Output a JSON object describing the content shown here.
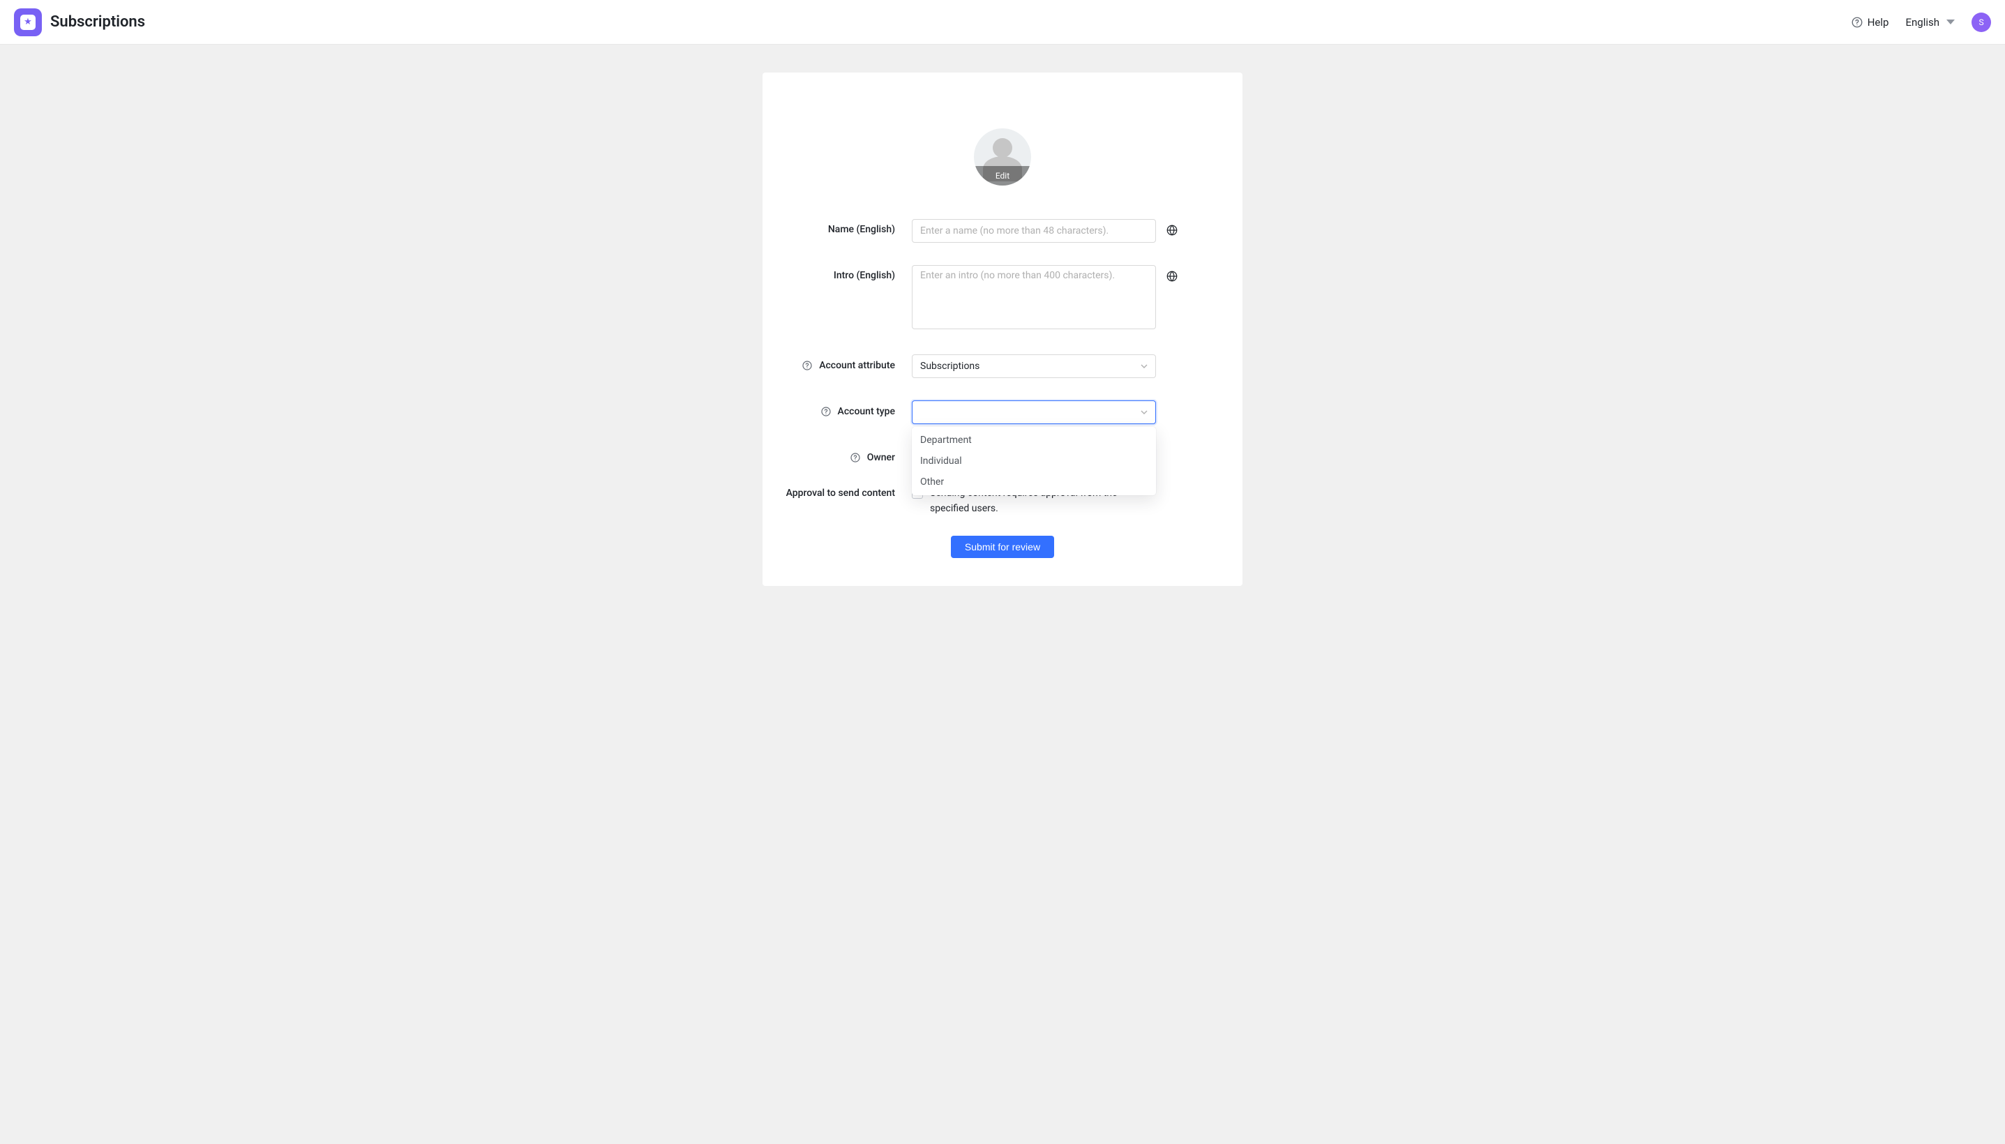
{
  "header": {
    "title": "Subscriptions",
    "help_label": "Help",
    "language_label": "English",
    "avatar_initial": "S"
  },
  "avatar": {
    "edit_label": "Edit"
  },
  "form": {
    "name": {
      "label": "Name (English)",
      "placeholder": "Enter a name (no more than 48 characters).",
      "value": ""
    },
    "intro": {
      "label": "Intro (English)",
      "placeholder": "Enter an intro (no more than 400 characters).",
      "value": ""
    },
    "account_attribute": {
      "label": "Account attribute",
      "value": "Subscriptions"
    },
    "account_type": {
      "label": "Account type",
      "value": "",
      "options": [
        "Department",
        "Individual",
        "Other"
      ]
    },
    "owner": {
      "label": "Owner"
    },
    "approval": {
      "label": "Approval to send content",
      "checkbox_label": "Sending content requires approval from the specified users.",
      "checked": false
    }
  },
  "submit_label": "Submit for review"
}
